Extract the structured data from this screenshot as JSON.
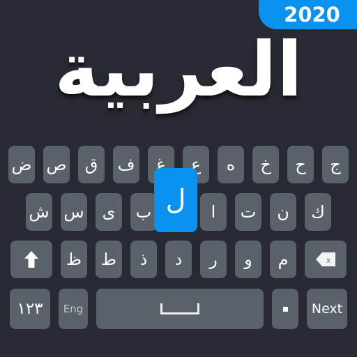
{
  "app": {
    "title": "العربية",
    "year_badge": "2020",
    "accent_color": "#0b92f0",
    "background_color": "#272a32",
    "key_color": "#5a6169",
    "key_text_color": "#ffffff"
  },
  "keyboard": {
    "layout_name": "arabic-qwerty",
    "rows": [
      {
        "name": "row-1",
        "keys": [
          {
            "label": "ض",
            "type": "letter"
          },
          {
            "label": "ص",
            "type": "letter"
          },
          {
            "label": "ق",
            "type": "letter"
          },
          {
            "label": "ف",
            "type": "letter"
          },
          {
            "label": "غ",
            "type": "letter"
          },
          {
            "label": "ع",
            "type": "letter"
          },
          {
            "label": "ه",
            "type": "letter"
          },
          {
            "label": "خ",
            "type": "letter"
          },
          {
            "label": "ح",
            "type": "letter"
          },
          {
            "label": "ج",
            "type": "letter"
          }
        ]
      },
      {
        "name": "row-2",
        "keys": [
          {
            "label": "ش",
            "type": "letter"
          },
          {
            "label": "س",
            "type": "letter"
          },
          {
            "label": "ى",
            "type": "letter"
          },
          {
            "label": "ب",
            "type": "letter"
          },
          {
            "label": "ل",
            "type": "letter",
            "state": "pressed"
          },
          {
            "label": "ا",
            "type": "letter"
          },
          {
            "label": "ت",
            "type": "letter"
          },
          {
            "label": "ن",
            "type": "letter"
          },
          {
            "label": "ك",
            "type": "letter"
          }
        ]
      },
      {
        "name": "row-3",
        "keys": [
          {
            "label": "",
            "type": "shift",
            "icon": "shift-arrow-icon"
          },
          {
            "label": "ظ",
            "type": "letter"
          },
          {
            "label": "ط",
            "type": "letter"
          },
          {
            "label": "ذ",
            "type": "letter"
          },
          {
            "label": "د",
            "type": "letter"
          },
          {
            "label": "ر",
            "type": "letter"
          },
          {
            "label": "و",
            "type": "letter"
          },
          {
            "label": "م",
            "type": "letter"
          },
          {
            "label": "",
            "type": "backspace",
            "icon": "backspace-icon"
          }
        ]
      },
      {
        "name": "row-4",
        "keys": [
          {
            "label": "١٢٣",
            "type": "numeric-switch"
          },
          {
            "label": "Eng",
            "type": "language-switch"
          },
          {
            "label": "",
            "type": "space",
            "icon": "spacebar-icon"
          },
          {
            "label": "",
            "type": "period",
            "icon": "dot-icon"
          },
          {
            "label": "Next",
            "type": "next"
          }
        ]
      }
    ]
  }
}
